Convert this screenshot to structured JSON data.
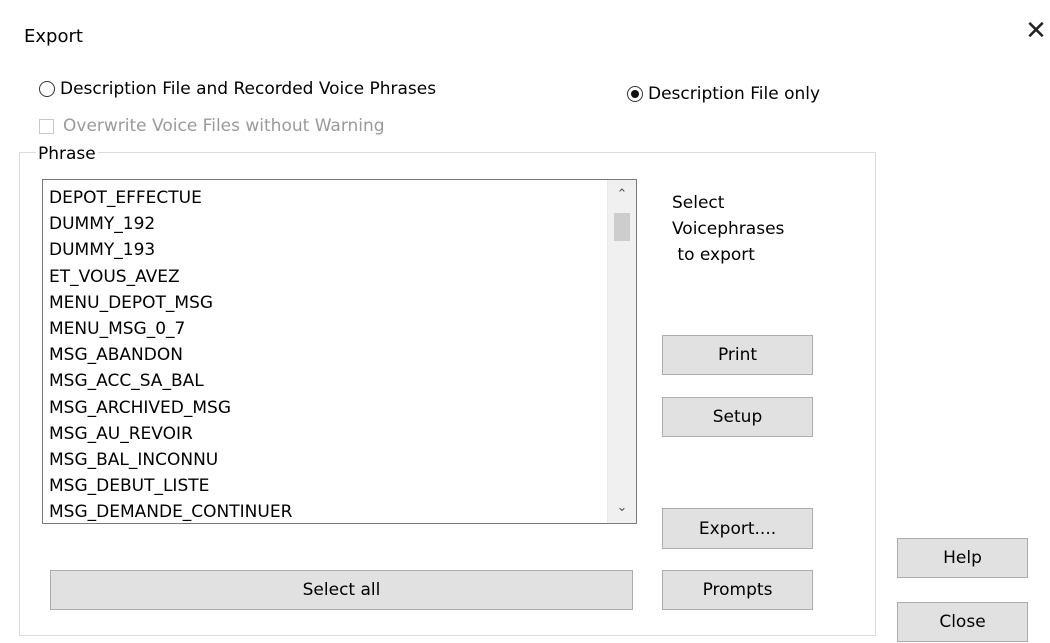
{
  "window": {
    "title": "Export",
    "close_glyph": "✕"
  },
  "options": {
    "radio_full": {
      "label": "Description File and Recorded Voice Phrases",
      "checked": false
    },
    "radio_desc_only": {
      "label": "Description File only",
      "checked": true
    },
    "overwrite_checkbox": {
      "label": "Overwrite Voice Files without Warning",
      "checked": false,
      "enabled": false
    }
  },
  "phrase_group": {
    "label": "Phrase",
    "items": [
      "DEPOT_EFFECTUE",
      "DUMMY_192",
      "DUMMY_193",
      "ET_VOUS_AVEZ",
      "MENU_DEPOT_MSG",
      "MENU_MSG_0_7",
      "MSG_ABANDON",
      "MSG_ACC_SA_BAL",
      "MSG_ARCHIVED_MSG",
      "MSG_AU_REVOIR",
      "MSG_BAL_INCONNU",
      "MSG_DEBUT_LISTE",
      "MSG_DEMANDE_CONTINUER"
    ],
    "scroll_up_glyph": "⌃",
    "scroll_down_glyph": "⌄",
    "hint_text": "Select\nVoicephrases\n to export",
    "select_all_label": "Select all"
  },
  "buttons": {
    "print": "Print",
    "setup": "Setup",
    "export": "Export....",
    "prompts": "Prompts",
    "help": "Help",
    "close": "Close"
  }
}
